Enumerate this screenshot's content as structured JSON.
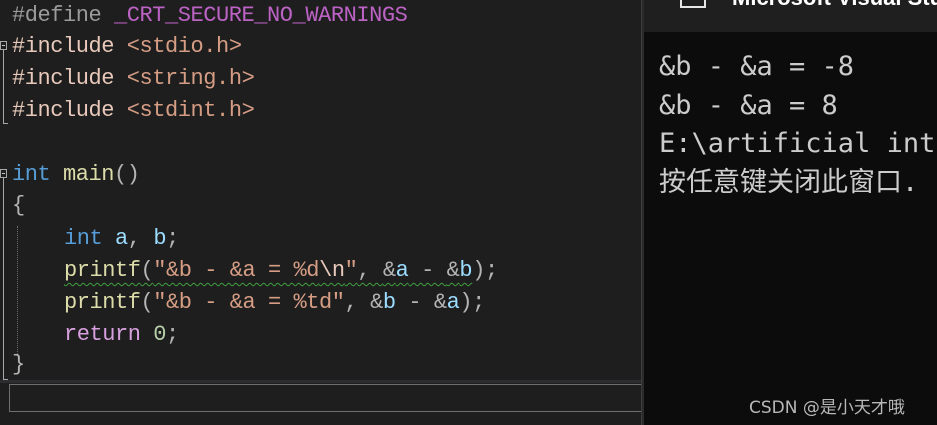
{
  "editor": {
    "lines": [
      {
        "parts": [
          "#define",
          " ",
          "_CRT_SECURE_NO_WARNINGS"
        ]
      },
      {
        "parts": [
          "#include",
          " ",
          "<stdio.h>"
        ]
      },
      {
        "parts": [
          "#include",
          " ",
          "<string.h>"
        ]
      },
      {
        "parts": [
          "#include",
          " ",
          "<stdint.h>"
        ]
      },
      {
        "parts": [
          "int",
          " ",
          "main",
          "()"
        ]
      },
      {
        "parts": [
          "{"
        ]
      },
      {
        "parts": [
          "int",
          " ",
          "a",
          ", ",
          "b",
          ";"
        ]
      },
      {
        "parts": [
          "printf",
          "(",
          "\"&b - &a = %d",
          "\\n",
          "\"",
          ", ",
          "&",
          "a",
          " - ",
          "&",
          "b",
          ");"
        ]
      },
      {
        "parts": [
          "printf",
          "(",
          "\"&b - &a = %td\"",
          ", ",
          "&",
          "b",
          " - ",
          "&",
          "a",
          ");"
        ]
      },
      {
        "parts": [
          "return",
          " ",
          "0",
          ";"
        ]
      },
      {
        "parts": [
          "}"
        ]
      }
    ],
    "find_box_value": ""
  },
  "console": {
    "title": "Microsoft Visual Studio",
    "output_lines": [
      "&b - &a = -8",
      "&b - &a = 8",
      "E:\\artificial intelligence",
      "按任意键关闭此窗口. . ."
    ]
  },
  "watermark": "CSDN @是小天才哦",
  "colors": {
    "editor_bg": "#1e1e1e",
    "console_bg": "#0c0c0c",
    "keyword": "#569cd6",
    "function": "#dcdcaa",
    "string": "#d69d85",
    "variable": "#9cdcfe",
    "macro": "#bd63c5",
    "squiggle": "#3fa13f"
  },
  "icons": {
    "console_app_icon": "console-window-icon",
    "fold_icon": "collapse-minus-icon"
  }
}
